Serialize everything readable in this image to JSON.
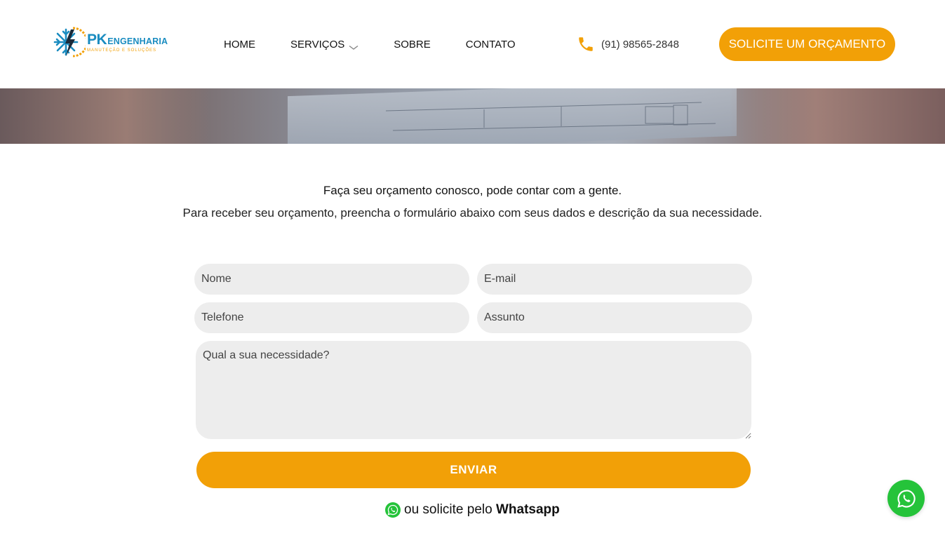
{
  "header": {
    "logo": {
      "brand_pk": "PK",
      "brand_name": "ENGENHARIA",
      "tagline": "MANUTEÇÃO E SOLUÇÕES"
    },
    "nav": [
      {
        "label": "HOME"
      },
      {
        "label": "SERVIÇOS",
        "has_dropdown": true
      },
      {
        "label": "SOBRE"
      },
      {
        "label": "CONTATO"
      }
    ],
    "phone": "(91) 98565-2848",
    "cta_label": "SOLICITE UM ORÇAMENTO"
  },
  "intro": {
    "title": "Faça seu orçamento conosco, pode contar com a gente.",
    "subtitle": "Para receber seu orçamento, preencha o formulário abaixo com seus dados e descrição da sua necessidade."
  },
  "form": {
    "name_placeholder": "Nome",
    "email_placeholder": "E-mail",
    "phone_placeholder": "Telefone",
    "subject_placeholder": "Assunto",
    "message_placeholder": "Qual a sua necessidade?",
    "submit_label": "ENVIAR"
  },
  "whatsapp": {
    "prefix": "ou solicite pelo ",
    "link_label": "Whatsapp"
  },
  "colors": {
    "accent": "#f2a007",
    "brand_blue": "#1a8cc0",
    "whatsapp_green": "#25c33a",
    "field_bg": "#ededed"
  },
  "icons": [
    "snowflake-bolt-logo-icon",
    "chevron-down-icon",
    "phone-icon",
    "whatsapp-icon"
  ]
}
